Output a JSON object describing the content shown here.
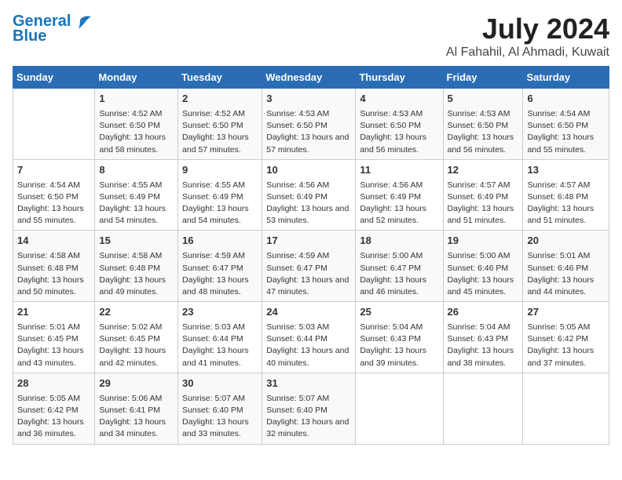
{
  "header": {
    "logo_line1": "General",
    "logo_line2": "Blue",
    "title": "July 2024",
    "subtitle": "Al Fahahil, Al Ahmadi, Kuwait"
  },
  "calendar": {
    "days_of_week": [
      "Sunday",
      "Monday",
      "Tuesday",
      "Wednesday",
      "Thursday",
      "Friday",
      "Saturday"
    ],
    "weeks": [
      [
        {
          "date": "",
          "sunrise": "",
          "sunset": "",
          "daylight": ""
        },
        {
          "date": "1",
          "sunrise": "Sunrise: 4:52 AM",
          "sunset": "Sunset: 6:50 PM",
          "daylight": "Daylight: 13 hours and 58 minutes."
        },
        {
          "date": "2",
          "sunrise": "Sunrise: 4:52 AM",
          "sunset": "Sunset: 6:50 PM",
          "daylight": "Daylight: 13 hours and 57 minutes."
        },
        {
          "date": "3",
          "sunrise": "Sunrise: 4:53 AM",
          "sunset": "Sunset: 6:50 PM",
          "daylight": "Daylight: 13 hours and 57 minutes."
        },
        {
          "date": "4",
          "sunrise": "Sunrise: 4:53 AM",
          "sunset": "Sunset: 6:50 PM",
          "daylight": "Daylight: 13 hours and 56 minutes."
        },
        {
          "date": "5",
          "sunrise": "Sunrise: 4:53 AM",
          "sunset": "Sunset: 6:50 PM",
          "daylight": "Daylight: 13 hours and 56 minutes."
        },
        {
          "date": "6",
          "sunrise": "Sunrise: 4:54 AM",
          "sunset": "Sunset: 6:50 PM",
          "daylight": "Daylight: 13 hours and 55 minutes."
        }
      ],
      [
        {
          "date": "7",
          "sunrise": "Sunrise: 4:54 AM",
          "sunset": "Sunset: 6:50 PM",
          "daylight": "Daylight: 13 hours and 55 minutes."
        },
        {
          "date": "8",
          "sunrise": "Sunrise: 4:55 AM",
          "sunset": "Sunset: 6:49 PM",
          "daylight": "Daylight: 13 hours and 54 minutes."
        },
        {
          "date": "9",
          "sunrise": "Sunrise: 4:55 AM",
          "sunset": "Sunset: 6:49 PM",
          "daylight": "Daylight: 13 hours and 54 minutes."
        },
        {
          "date": "10",
          "sunrise": "Sunrise: 4:56 AM",
          "sunset": "Sunset: 6:49 PM",
          "daylight": "Daylight: 13 hours and 53 minutes."
        },
        {
          "date": "11",
          "sunrise": "Sunrise: 4:56 AM",
          "sunset": "Sunset: 6:49 PM",
          "daylight": "Daylight: 13 hours and 52 minutes."
        },
        {
          "date": "12",
          "sunrise": "Sunrise: 4:57 AM",
          "sunset": "Sunset: 6:49 PM",
          "daylight": "Daylight: 13 hours and 51 minutes."
        },
        {
          "date": "13",
          "sunrise": "Sunrise: 4:57 AM",
          "sunset": "Sunset: 6:48 PM",
          "daylight": "Daylight: 13 hours and 51 minutes."
        }
      ],
      [
        {
          "date": "14",
          "sunrise": "Sunrise: 4:58 AM",
          "sunset": "Sunset: 6:48 PM",
          "daylight": "Daylight: 13 hours and 50 minutes."
        },
        {
          "date": "15",
          "sunrise": "Sunrise: 4:58 AM",
          "sunset": "Sunset: 6:48 PM",
          "daylight": "Daylight: 13 hours and 49 minutes."
        },
        {
          "date": "16",
          "sunrise": "Sunrise: 4:59 AM",
          "sunset": "Sunset: 6:47 PM",
          "daylight": "Daylight: 13 hours and 48 minutes."
        },
        {
          "date": "17",
          "sunrise": "Sunrise: 4:59 AM",
          "sunset": "Sunset: 6:47 PM",
          "daylight": "Daylight: 13 hours and 47 minutes."
        },
        {
          "date": "18",
          "sunrise": "Sunrise: 5:00 AM",
          "sunset": "Sunset: 6:47 PM",
          "daylight": "Daylight: 13 hours and 46 minutes."
        },
        {
          "date": "19",
          "sunrise": "Sunrise: 5:00 AM",
          "sunset": "Sunset: 6:46 PM",
          "daylight": "Daylight: 13 hours and 45 minutes."
        },
        {
          "date": "20",
          "sunrise": "Sunrise: 5:01 AM",
          "sunset": "Sunset: 6:46 PM",
          "daylight": "Daylight: 13 hours and 44 minutes."
        }
      ],
      [
        {
          "date": "21",
          "sunrise": "Sunrise: 5:01 AM",
          "sunset": "Sunset: 6:45 PM",
          "daylight": "Daylight: 13 hours and 43 minutes."
        },
        {
          "date": "22",
          "sunrise": "Sunrise: 5:02 AM",
          "sunset": "Sunset: 6:45 PM",
          "daylight": "Daylight: 13 hours and 42 minutes."
        },
        {
          "date": "23",
          "sunrise": "Sunrise: 5:03 AM",
          "sunset": "Sunset: 6:44 PM",
          "daylight": "Daylight: 13 hours and 41 minutes."
        },
        {
          "date": "24",
          "sunrise": "Sunrise: 5:03 AM",
          "sunset": "Sunset: 6:44 PM",
          "daylight": "Daylight: 13 hours and 40 minutes."
        },
        {
          "date": "25",
          "sunrise": "Sunrise: 5:04 AM",
          "sunset": "Sunset: 6:43 PM",
          "daylight": "Daylight: 13 hours and 39 minutes."
        },
        {
          "date": "26",
          "sunrise": "Sunrise: 5:04 AM",
          "sunset": "Sunset: 6:43 PM",
          "daylight": "Daylight: 13 hours and 38 minutes."
        },
        {
          "date": "27",
          "sunrise": "Sunrise: 5:05 AM",
          "sunset": "Sunset: 6:42 PM",
          "daylight": "Daylight: 13 hours and 37 minutes."
        }
      ],
      [
        {
          "date": "28",
          "sunrise": "Sunrise: 5:05 AM",
          "sunset": "Sunset: 6:42 PM",
          "daylight": "Daylight: 13 hours and 36 minutes."
        },
        {
          "date": "29",
          "sunrise": "Sunrise: 5:06 AM",
          "sunset": "Sunset: 6:41 PM",
          "daylight": "Daylight: 13 hours and 34 minutes."
        },
        {
          "date": "30",
          "sunrise": "Sunrise: 5:07 AM",
          "sunset": "Sunset: 6:40 PM",
          "daylight": "Daylight: 13 hours and 33 minutes."
        },
        {
          "date": "31",
          "sunrise": "Sunrise: 5:07 AM",
          "sunset": "Sunset: 6:40 PM",
          "daylight": "Daylight: 13 hours and 32 minutes."
        },
        {
          "date": "",
          "sunrise": "",
          "sunset": "",
          "daylight": ""
        },
        {
          "date": "",
          "sunrise": "",
          "sunset": "",
          "daylight": ""
        },
        {
          "date": "",
          "sunrise": "",
          "sunset": "",
          "daylight": ""
        }
      ]
    ]
  }
}
